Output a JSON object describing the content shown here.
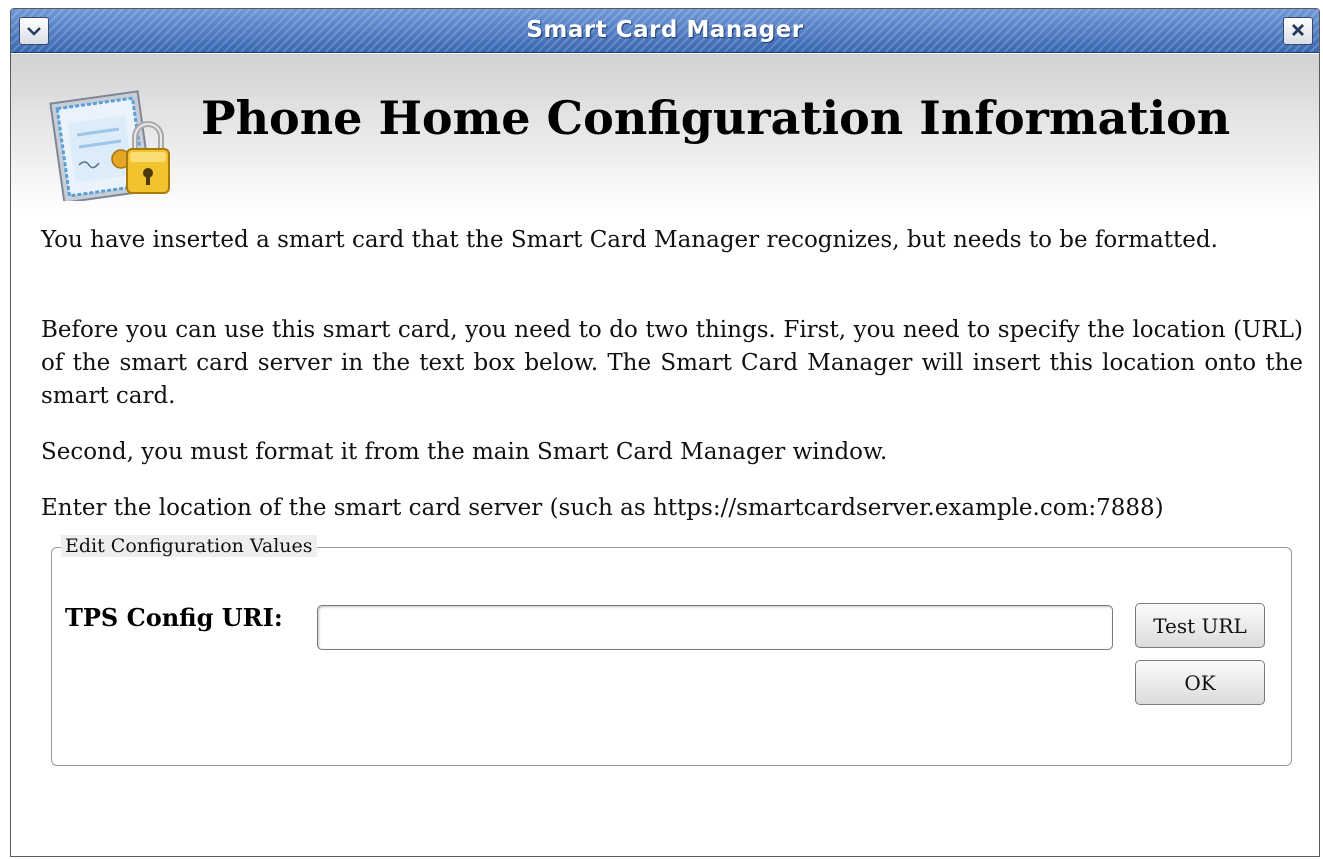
{
  "window": {
    "title": "Smart Card Manager",
    "menu_icon": "chevron-down-icon",
    "close_icon": "close-icon",
    "titlebar_color": "#3d6cb5"
  },
  "header": {
    "title": "Phone Home Configuration Information",
    "icon": "certificate-lock-icon"
  },
  "body": {
    "paragraph_1": "You have inserted a smart card that the Smart Card Manager recognizes, but needs to be formatted.",
    "paragraph_2": "Before you can use this smart card, you need to do two things. First, you need to specify the location (URL) of the smart card server in the text box below. The Smart Card Manager will insert this location onto the smart card.",
    "paragraph_3": "Second, you must format it from the main Smart Card Manager window.",
    "paragraph_4": "Enter the location of the smart card server (such as https://smartcardserver.example.com:7888)"
  },
  "config_group": {
    "legend": "Edit Configuration Values",
    "uri_label": "TPS Config URI:",
    "uri_value": "",
    "uri_placeholder": "",
    "test_button_label": "Test URL",
    "ok_button_label": "OK"
  }
}
